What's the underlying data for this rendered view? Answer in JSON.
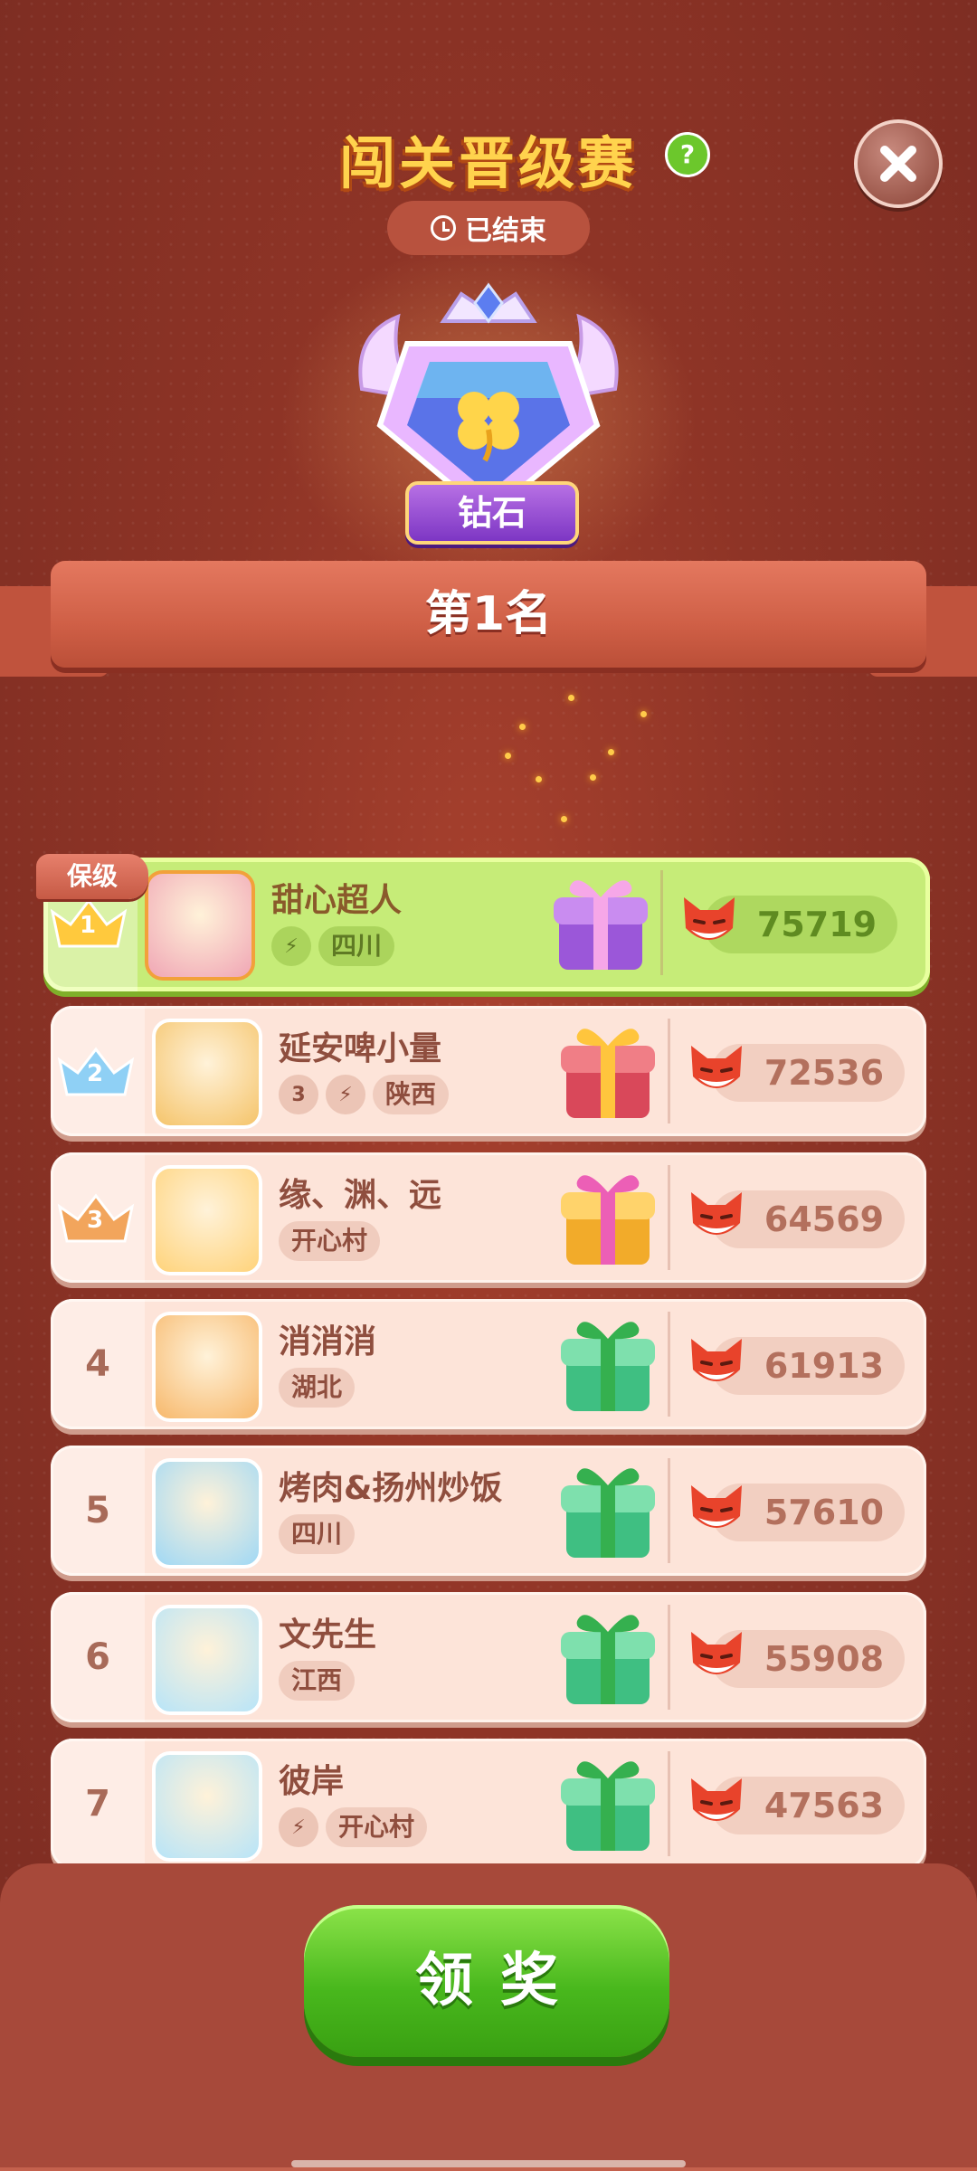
{
  "header": {
    "title": "闯关晋级赛",
    "help_glyph": "?",
    "status": "已结束"
  },
  "badge": {
    "tier": "钻石"
  },
  "rank_banner": "第1名",
  "keep_tag": "保级",
  "rows": [
    {
      "rank": "1",
      "name": "甜心超人",
      "level": "",
      "tags": [
        "四川"
      ],
      "score": "75719",
      "gift": "purple",
      "me": true
    },
    {
      "rank": "2",
      "name": "延安啤小量",
      "level": "3",
      "tags": [
        "陕西"
      ],
      "score": "72536",
      "gift": "red"
    },
    {
      "rank": "3",
      "name": "缘、渊、远",
      "level": "",
      "tags": [
        "开心村"
      ],
      "score": "64569",
      "gift": "pink"
    },
    {
      "rank": "4",
      "name": "消消消",
      "level": "",
      "tags": [
        "湖北"
      ],
      "score": "61913",
      "gift": "green"
    },
    {
      "rank": "5",
      "name": "烤肉&扬州炒饭",
      "level": "",
      "tags": [
        "四川"
      ],
      "score": "57610",
      "gift": "green"
    },
    {
      "rank": "6",
      "name": "文先生",
      "level": "",
      "tags": [
        "江西"
      ],
      "score": "55908",
      "gift": "green"
    },
    {
      "rank": "7",
      "name": "彼岸",
      "level": "",
      "tags": [
        "开心村"
      ],
      "score": "47563",
      "gift": "green"
    }
  ],
  "claim_button": "领奖",
  "colors": {
    "accent_green": "#49b81d",
    "background": "#8e3426",
    "title_gold": "#ffd34d"
  }
}
